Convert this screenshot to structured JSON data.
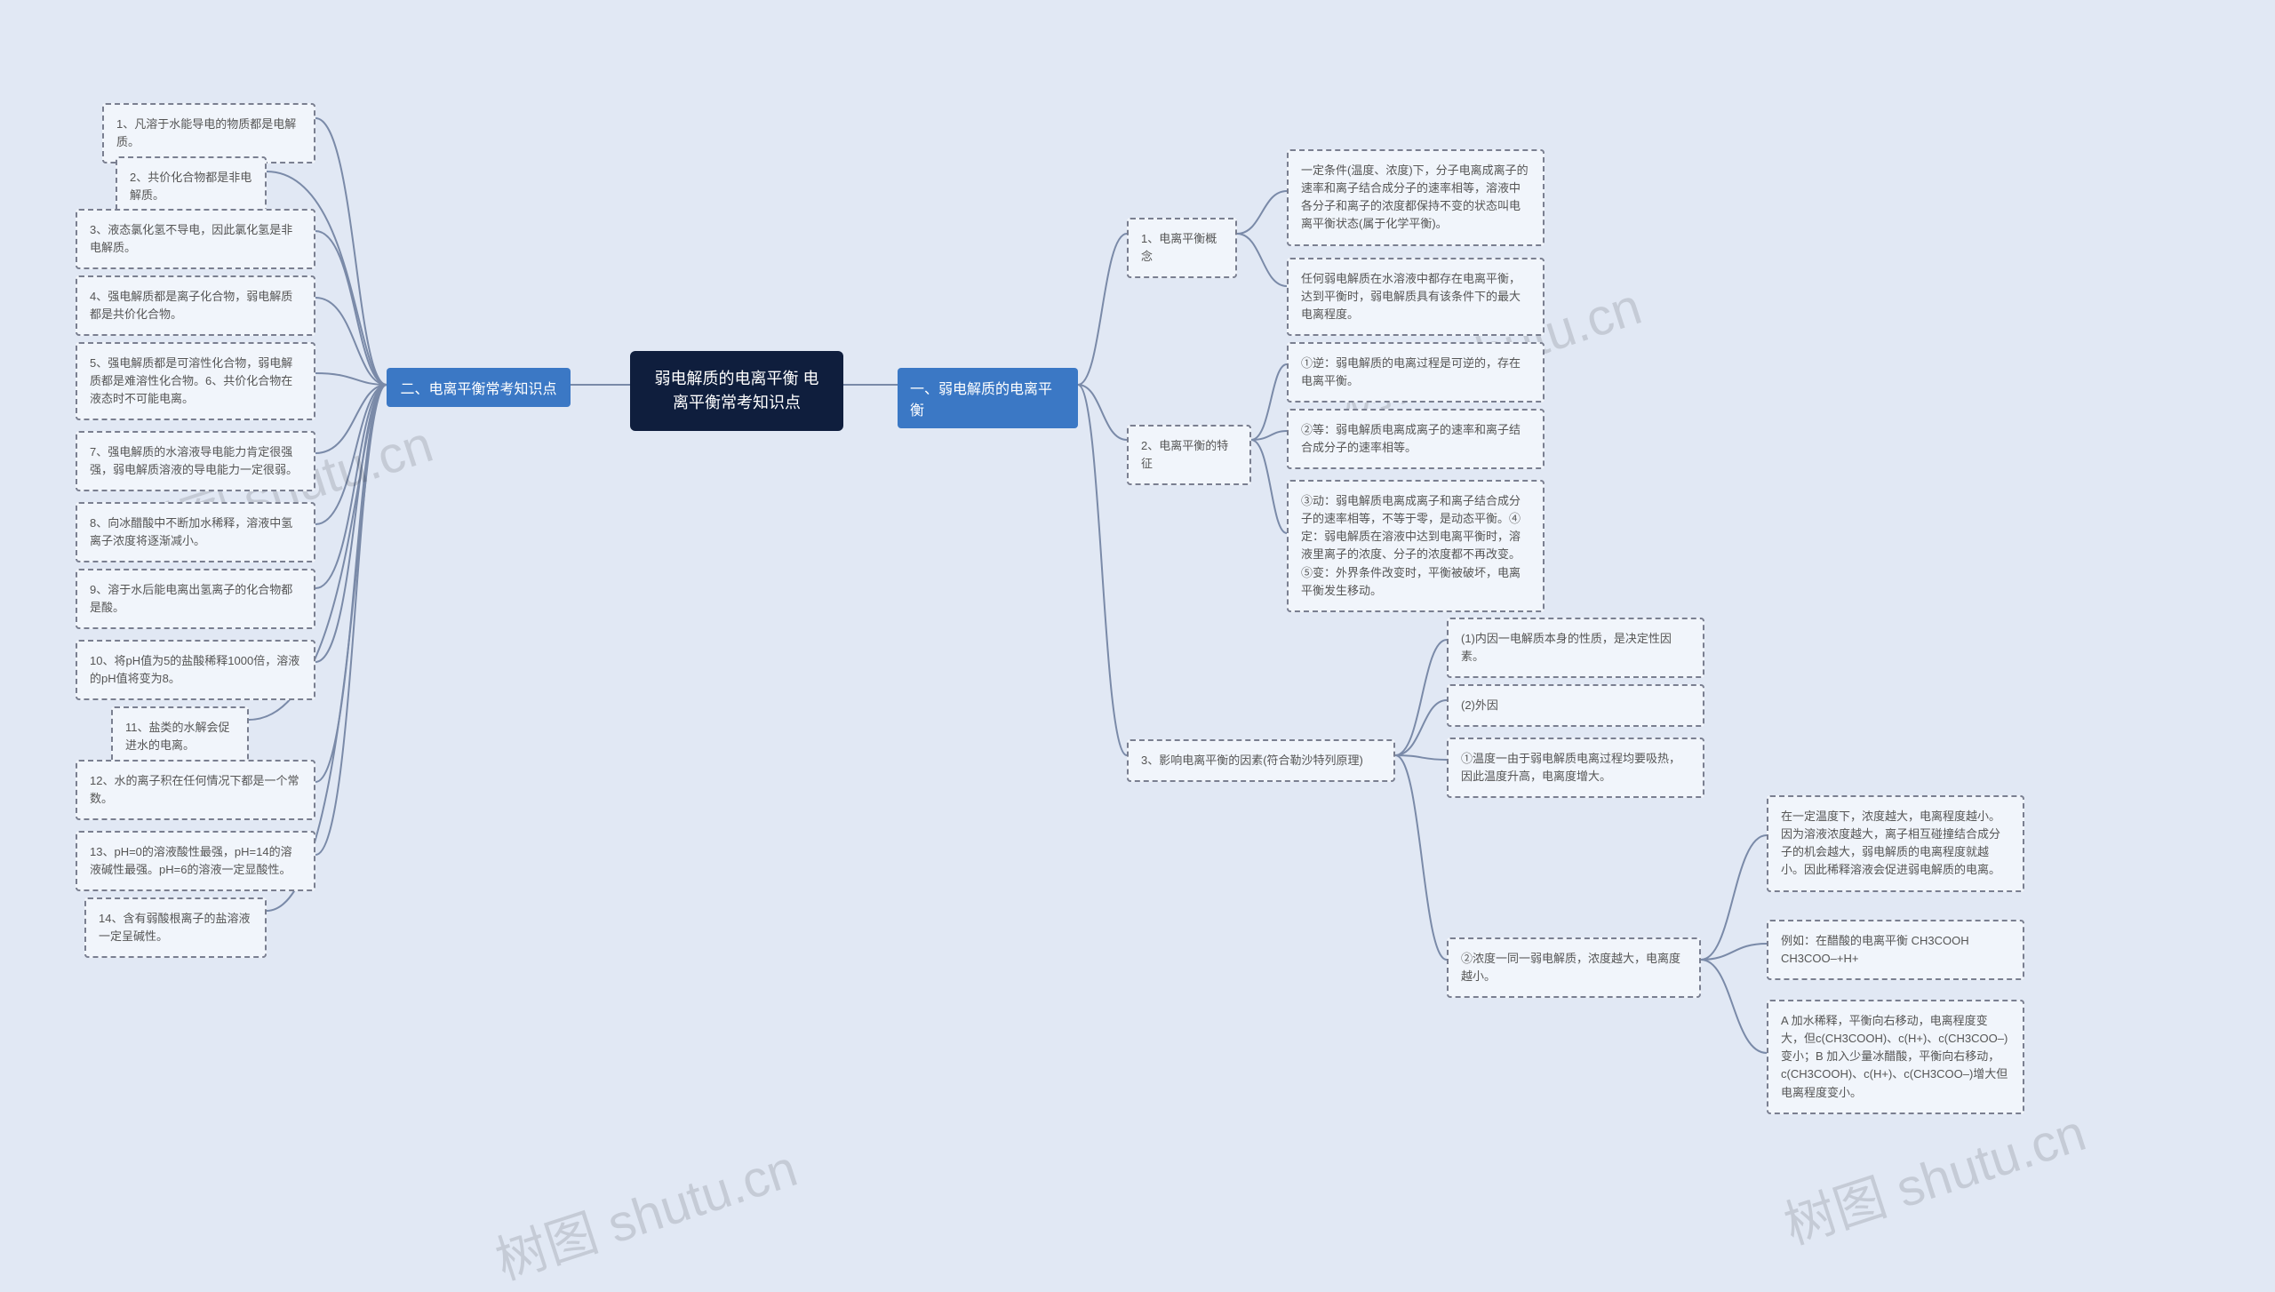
{
  "root": {
    "title": "弱电解质的电离平衡 电离平衡常考知识点"
  },
  "right": {
    "branch": "一、弱电解质的电离平衡",
    "n1": {
      "label": "1、电离平衡概念",
      "c1": "一定条件(温度、浓度)下，分子电离成离子的速率和离子结合成分子的速率相等，溶液中各分子和离子的浓度都保持不变的状态叫电离平衡状态(属于化学平衡)。",
      "c2": "任何弱电解质在水溶液中都存在电离平衡，达到平衡时，弱电解质具有该条件下的最大电离程度。"
    },
    "n2": {
      "label": "2、电离平衡的特征",
      "c1": "①逆：弱电解质的电离过程是可逆的，存在电离平衡。",
      "c2": "②等：弱电解质电离成离子的速率和离子结合成分子的速率相等。",
      "c3": "③动：弱电解质电离成离子和离子结合成分子的速率相等，不等于零，是动态平衡。④定：弱电解质在溶液中达到电离平衡时，溶液里离子的浓度、分子的浓度都不再改变。⑤变：外界条件改变时，平衡被破坏，电离平衡发生移动。"
    },
    "n3": {
      "label": "3、影响电离平衡的因素(符合勒沙特列原理)",
      "c1": "(1)内因一电解质本身的性质，是决定性因素。",
      "c2": "(2)外因",
      "c3": "①温度一由于弱电解质电离过程均要吸热，因此温度升高，电离度增大。",
      "c4": {
        "label": "②浓度一同一弱电解质，浓度越大，电离度越小。",
        "d1": "在一定温度下，浓度越大，电离程度越小。因为溶液浓度越大，离子相互碰撞结合成分子的机会越大，弱电解质的电离程度就越小。因此稀释溶液会促进弱电解质的电离。",
        "d2": "例如：在醋酸的电离平衡 CH3COOH CH3COO–+H+",
        "d3": "A 加水稀释，平衡向右移动，电离程度变大，但c(CH3COOH)、c(H+)、c(CH3COO–)变小；B 加入少量冰醋酸，平衡向右移动，c(CH3COOH)、c(H+)、c(CH3COO–)增大但电离程度变小。"
      }
    }
  },
  "left": {
    "branch": "二、电离平衡常考知识点",
    "items": [
      "1、凡溶于水能导电的物质都是电解质。",
      "2、共价化合物都是非电解质。",
      "3、液态氯化氢不导电，因此氯化氢是非电解质。",
      "4、强电解质都是离子化合物，弱电解质都是共价化合物。",
      "5、强电解质都是可溶性化合物，弱电解质都是难溶性化合物。6、共价化合物在液态时不可能电离。",
      "7、强电解质的水溶液导电能力肯定很强强，弱电解质溶液的导电能力一定很弱。",
      "8、向冰醋酸中不断加水稀释，溶液中氢离子浓度将逐渐减小。",
      "9、溶于水后能电离出氢离子的化合物都是酸。",
      "10、将pH值为5的盐酸稀释1000倍，溶液的pH值将变为8。",
      "11、盐类的水解会促进水的电离。",
      "12、水的离子积在任何情况下都是一个常数。",
      "13、pH=0的溶液酸性最强，pH=14的溶液碱性最强。pH=6的溶液一定显酸性。",
      "14、含有弱酸根离子的盐溶液一定呈碱性。"
    ]
  },
  "watermark": "树图 shutu.cn"
}
